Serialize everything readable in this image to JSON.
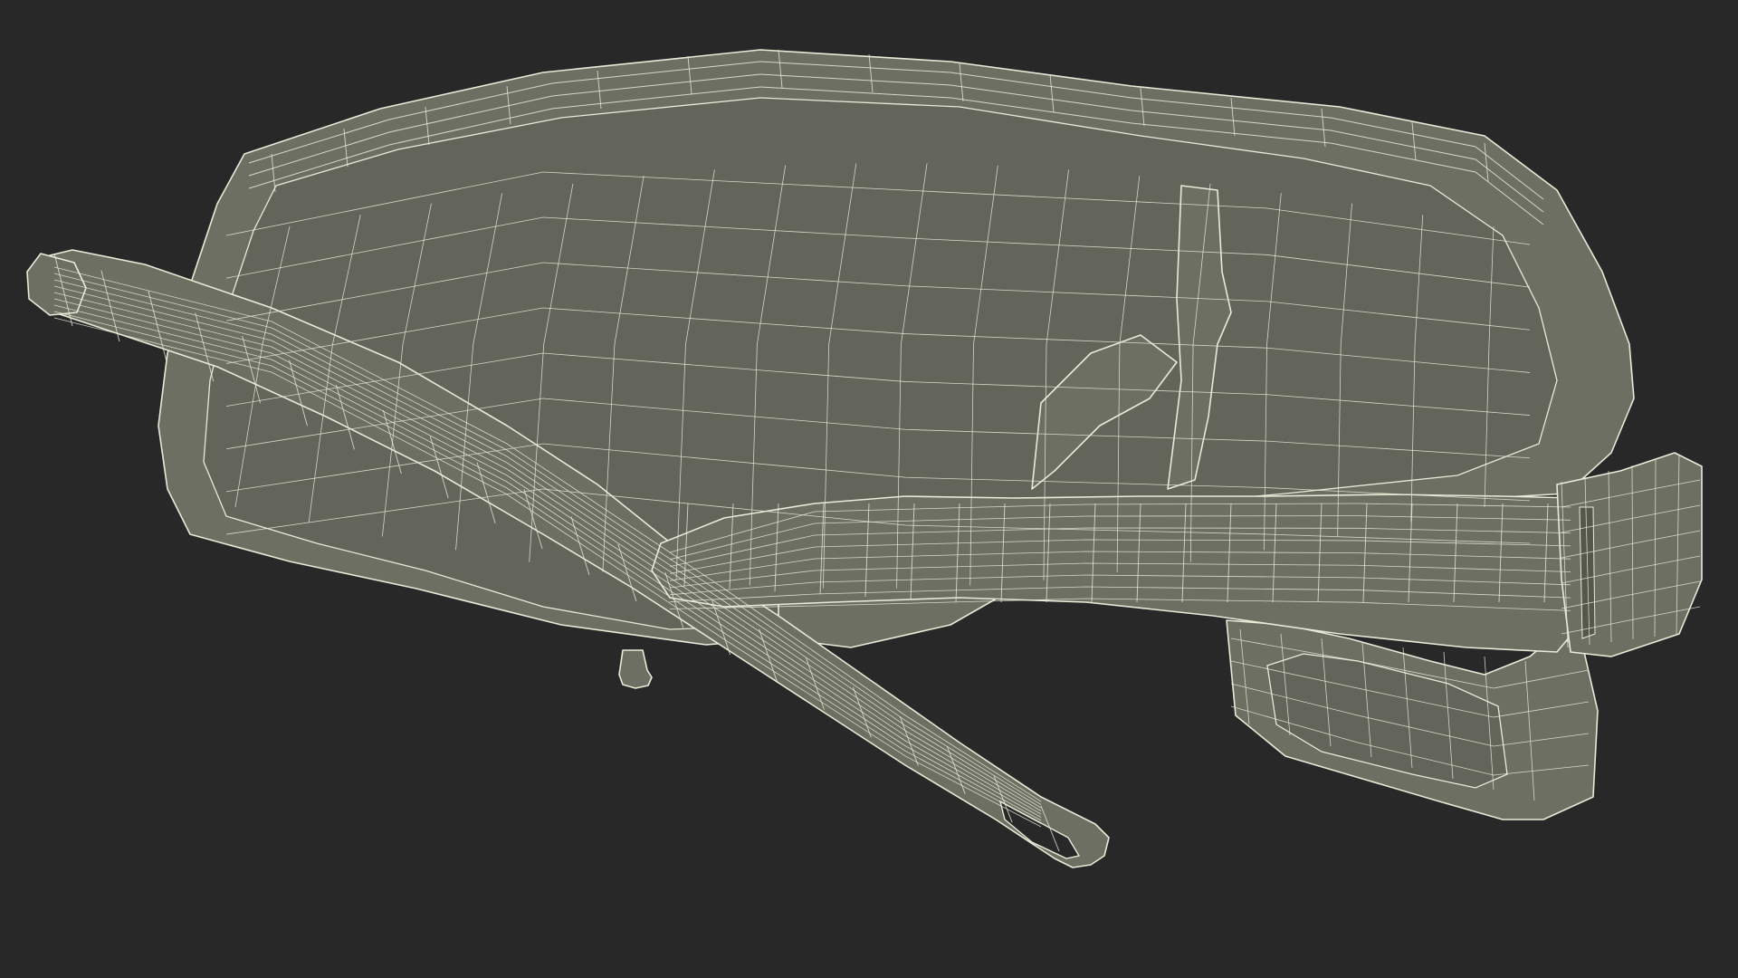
{
  "scene": {
    "subject": "safety-glasses-wireframe",
    "render_style": "clay-with-wireframe-overlay",
    "colors": {
      "background": "#282828",
      "surface": "#6e6f63",
      "surface_light": "#85867a",
      "surface_dark": "#55564c",
      "cavity": "#63645a",
      "wire": "#e9ead8"
    }
  }
}
